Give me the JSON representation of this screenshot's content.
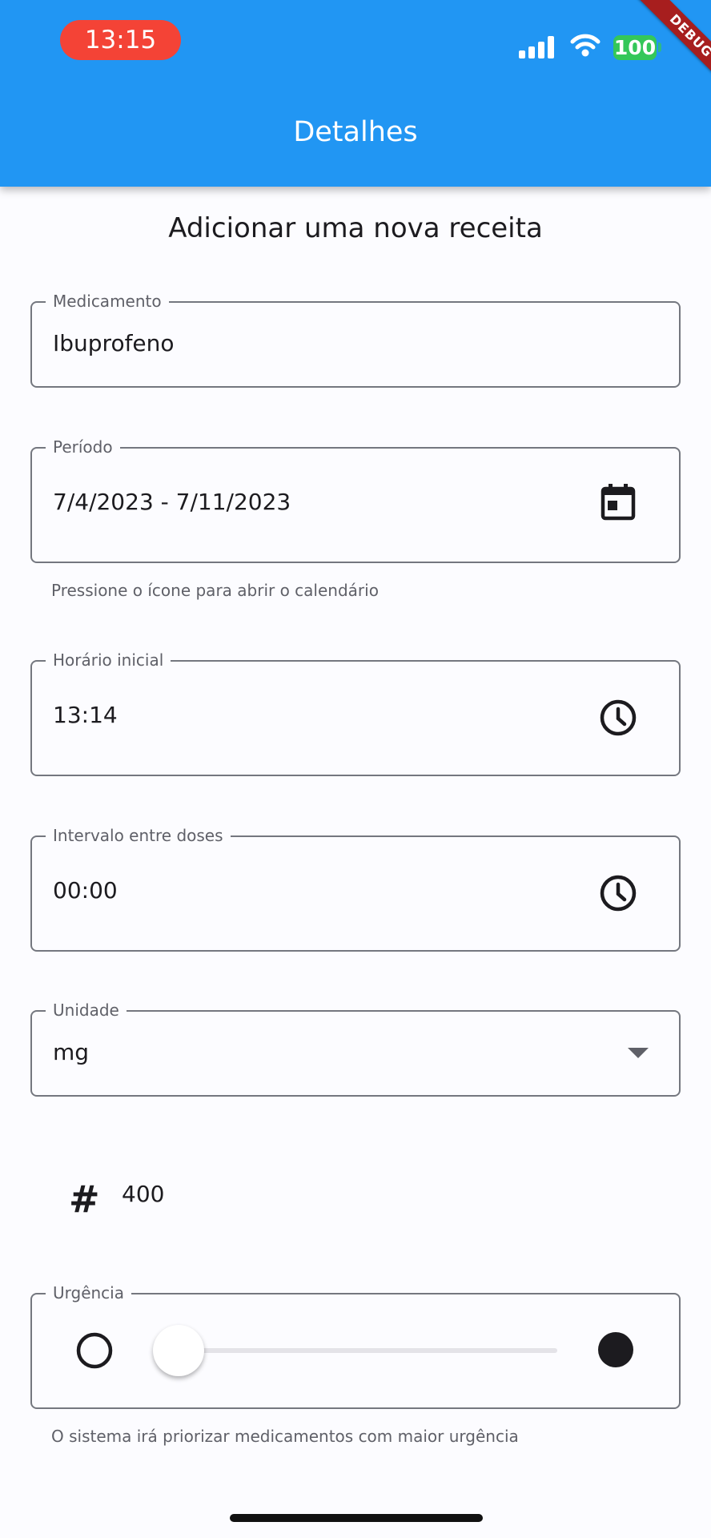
{
  "status_bar": {
    "time": "13:15",
    "battery": "100",
    "debug_label": "DEBUG"
  },
  "app_bar": {
    "title": "Detalhes"
  },
  "page": {
    "heading": "Adicionar uma nova receita"
  },
  "form": {
    "medication": {
      "label": "Medicamento",
      "value": "Ibuprofeno"
    },
    "period": {
      "label": "Período",
      "value": "7/4/2023 - 7/11/2023",
      "helper": "Pressione o ícone para abrir o calendário",
      "icon": "calendar-icon"
    },
    "start_time": {
      "label": "Horário inicial",
      "value": "13:14",
      "icon": "clock-icon"
    },
    "dose_interval": {
      "label": "Intervalo entre doses",
      "value": "00:00",
      "icon": "clock-icon"
    },
    "unit": {
      "label": "Unidade",
      "value": "mg",
      "icon": "dropdown-arrow-icon"
    },
    "quantity": {
      "value": "400",
      "icon": "hash-icon"
    },
    "urgency": {
      "label": "Urgência",
      "level": 0,
      "helper": "O sistema irá priorizar medicamentos com maior urgência",
      "icons": [
        "circle-outline-icon",
        "circle-filled-icon"
      ]
    }
  },
  "colors": {
    "app_bar": "#2196f3",
    "time_pill": "#f44336",
    "battery": "#34c759",
    "debug_ribbon": "#a71e1e",
    "outline": "#74777f"
  }
}
